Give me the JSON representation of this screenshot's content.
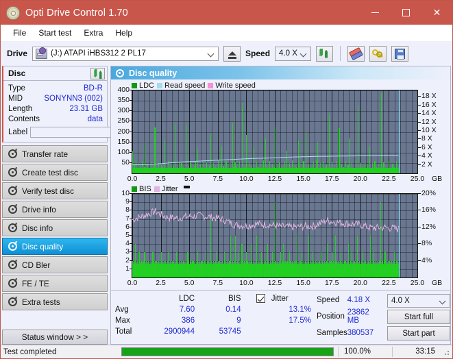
{
  "window": {
    "title": "Opti Drive Control 1.70",
    "icon": "disc-icon",
    "controls": {
      "minimize": "–",
      "maximize": "□",
      "close": "✕"
    }
  },
  "menu": {
    "items": [
      "File",
      "Start test",
      "Extra",
      "Help"
    ]
  },
  "toolbar": {
    "drive_label": "Drive",
    "drive_value": "(J:)   ATAPI iHBS312   2 PL17",
    "eject_icon": "eject-icon",
    "speed_label": "Speed",
    "speed_value": "4.0 X",
    "refresh_icon": "refresh-icon",
    "erase_icon": "eraser-icon",
    "key_icon": "key-icon",
    "save_icon": "save-icon"
  },
  "sidebar": {
    "disc_panel": {
      "title": "Disc",
      "refresh_icon": "refresh-icon",
      "rows": [
        {
          "key": "Type",
          "value": "BD-R"
        },
        {
          "key": "MID",
          "value": "SONYNN3 (002)"
        },
        {
          "key": "Length",
          "value": "23.31 GB"
        },
        {
          "key": "Contents",
          "value": "data"
        }
      ],
      "label_key": "Label",
      "label_value": "",
      "label_placeholder": "",
      "disc_icon": "cd-icon"
    },
    "items": [
      {
        "label": "Transfer rate",
        "active": false
      },
      {
        "label": "Create test disc",
        "active": false
      },
      {
        "label": "Verify test disc",
        "active": false
      },
      {
        "label": "Drive info",
        "active": false
      },
      {
        "label": "Disc info",
        "active": false
      },
      {
        "label": "Disc quality",
        "active": true
      },
      {
        "label": "CD Bler",
        "active": false
      },
      {
        "label": "FE / TE",
        "active": false
      },
      {
        "label": "Extra tests",
        "active": false
      }
    ],
    "status_window_button": "Status window > >"
  },
  "main": {
    "header_title": "Disc quality",
    "header_icon": "disc-quality-icon"
  },
  "chart_data": [
    {
      "type": "bar",
      "id": "ldc-chart",
      "title": "",
      "legend": [
        {
          "label": "LDC",
          "color": "#119911"
        },
        {
          "label": "Read speed",
          "color": "#9fdcf5"
        },
        {
          "label": "Write speed",
          "color": "#f58fd8"
        }
      ],
      "legend_position": "top-left",
      "xlabel": "GB",
      "ylabel": "",
      "xlim": [
        0,
        25
      ],
      "ylim": [
        0,
        400
      ],
      "xticks": [
        "0.0",
        "2.5",
        "5.0",
        "7.5",
        "10.0",
        "12.5",
        "15.0",
        "17.5",
        "20.0",
        "22.5",
        "25.0"
      ],
      "yticks": [
        50,
        100,
        150,
        200,
        250,
        300,
        350,
        400
      ],
      "y2ticks": [
        "2 X",
        "4 X",
        "6 X",
        "8 X",
        "10 X",
        "12 X",
        "14 X",
        "16 X",
        "18 X"
      ],
      "y2lim": [
        0,
        19.5
      ],
      "grid": true,
      "plot_bg": "#697790",
      "series": [
        {
          "name": "LDC",
          "color": "#22d022",
          "note": "dense error-count spikes across 0-23.3 GB, baseline ~20-60, frequent peaks 100-250, max 386",
          "values": [
            105,
            22,
            40,
            18,
            62,
            26,
            14,
            48,
            20,
            34,
            16,
            58,
            12,
            30,
            150,
            24,
            18,
            44,
            12,
            28,
            16,
            60,
            22,
            14,
            36,
            220,
            18,
            26,
            14,
            50,
            20,
            12,
            42,
            16,
            30,
            24,
            160,
            14,
            36,
            18,
            58,
            22,
            12,
            44,
            26,
            16,
            38,
            12,
            240,
            18,
            30,
            14,
            56,
            20,
            12,
            48,
            16,
            34,
            26,
            18,
            238,
            14,
            40,
            22,
            12,
            52,
            18,
            28,
            14,
            36,
            20,
            58,
            16,
            120,
            24,
            14,
            46,
            18,
            30,
            12,
            64,
            22,
            16,
            54,
            26,
            14,
            38,
            18,
            190,
            24,
            12,
            50,
            16,
            32,
            20,
            14,
            62,
            26,
            18,
            44,
            130,
            16,
            36,
            22,
            12,
            58,
            18,
            26,
            14,
            48,
            20,
            16,
            244,
            30,
            12,
            54,
            18,
            34,
            22,
            14,
            60,
            26,
            16,
            340,
            24,
            12,
            46,
            18,
            186,
            28,
            14,
            52,
            20,
            16,
            38,
            24,
            130,
            18,
            12,
            56,
            22,
            30,
            14,
            48,
            18,
            26,
            16,
            62,
            22,
            170,
            14,
            40,
            18,
            12,
            58,
            24,
            16,
            46,
            20,
            30,
            14,
            222,
            18,
            26,
            12,
            54,
            20,
            16,
            38,
            24,
            14,
            58,
            18,
            110,
            26,
            12,
            48,
            20,
            16,
            62,
            24,
            14,
            40,
            18,
            30,
            22,
            160,
            12,
            52,
            18,
            26,
            14,
            58,
            20,
            16,
            200,
            28,
            12,
            44,
            18,
            34,
            22,
            14,
            56,
            20,
            16,
            62,
            24,
            150,
            18,
            12,
            48,
            26,
            14,
            58,
            20,
            30,
            16,
            44,
            18,
            12,
            286,
            24,
            14,
            52,
            18,
            28,
            20,
            16,
            60,
            22,
            14,
            218,
            26,
            12,
            46,
            18,
            30,
            14,
            58,
            22,
            16,
            40,
            170,
            24,
            12,
            54,
            18,
            26,
            20,
            14,
            62,
            16,
            324,
            22,
            12,
            48,
            18,
            32,
            24,
            14,
            56,
            20,
            16,
            42,
            18,
            130,
            26,
            12,
            50,
            22,
            14,
            58,
            18,
            30,
            16,
            44,
            24,
            12,
            388,
            20,
            14,
            52,
            18,
            28,
            22,
            16,
            60,
            14,
            24,
            18,
            12,
            46,
            20,
            30,
            14,
            58,
            22,
            16
          ]
        },
        {
          "name": "Read speed",
          "color": "#a8ddf5",
          "note": "stair-stepping CAV-like read speed from ~2.0X at 0 GB up to ~4.2X at 23.3 GB",
          "points": [
            {
              "x": 0.0,
              "y": 2.0
            },
            {
              "x": 1.5,
              "y": 2.1
            },
            {
              "x": 3.0,
              "y": 2.4
            },
            {
              "x": 4.5,
              "y": 2.7
            },
            {
              "x": 6.0,
              "y": 2.9
            },
            {
              "x": 7.5,
              "y": 3.1
            },
            {
              "x": 9.0,
              "y": 3.3
            },
            {
              "x": 10.5,
              "y": 3.5
            },
            {
              "x": 12.0,
              "y": 3.6
            },
            {
              "x": 13.5,
              "y": 3.8
            },
            {
              "x": 15.0,
              "y": 3.9
            },
            {
              "x": 16.5,
              "y": 4.0
            },
            {
              "x": 18.0,
              "y": 4.05
            },
            {
              "x": 19.5,
              "y": 4.1
            },
            {
              "x": 21.0,
              "y": 4.15
            },
            {
              "x": 22.0,
              "y": 4.2
            },
            {
              "x": 23.3,
              "y": 4.2
            }
          ]
        },
        {
          "name": "Write speed",
          "color": "#f58fd8",
          "values": []
        }
      ],
      "cursor_x": 23.35
    },
    {
      "type": "bar",
      "id": "bis-chart",
      "title": "",
      "legend": [
        {
          "label": "BIS",
          "color": "#119911"
        },
        {
          "label": "Jitter",
          "color": "#e0b4de"
        }
      ],
      "legend_position": "top-left",
      "xlabel": "GB",
      "ylabel": "",
      "xlim": [
        0,
        25
      ],
      "ylim": [
        0,
        10
      ],
      "xticks": [
        "0.0",
        "2.5",
        "5.0",
        "7.5",
        "10.0",
        "12.5",
        "15.0",
        "17.5",
        "20.0",
        "22.5",
        "25.0"
      ],
      "yticks": [
        1,
        2,
        3,
        4,
        5,
        6,
        7,
        8,
        9,
        10
      ],
      "y2ticks": [
        "4%",
        "8%",
        "12%",
        "16%",
        "20%"
      ],
      "y2lim": [
        0,
        20
      ],
      "grid": true,
      "plot_bg": "#697790",
      "series": [
        {
          "name": "BIS",
          "color": "#22d022",
          "note": "dense baseline ~1-2 with frequent spikes to 3-5, occasional to 9",
          "values": [
            2,
            1,
            2,
            4,
            1,
            2,
            1,
            3,
            2,
            1,
            2,
            1,
            2,
            3,
            1,
            2,
            1,
            2,
            2,
            1,
            2,
            1,
            3,
            2,
            1,
            2,
            2,
            1,
            2,
            1,
            2,
            3,
            1,
            2,
            1,
            2,
            2,
            1,
            2,
            3,
            1,
            2,
            1,
            2,
            1,
            2,
            2,
            1,
            3,
            2,
            1,
            2,
            1,
            2,
            1,
            2,
            2,
            1,
            2,
            1,
            3,
            2,
            1,
            2,
            1,
            2,
            2,
            1,
            2,
            1,
            2,
            3,
            1,
            2,
            1,
            2,
            2,
            1,
            2,
            1,
            3,
            2,
            1,
            2,
            1,
            7,
            2,
            1,
            2,
            1,
            2,
            3,
            1,
            2,
            1,
            2,
            2,
            1,
            2,
            1,
            3,
            2,
            1,
            2,
            1,
            2,
            2,
            5,
            1,
            2,
            1,
            2,
            5,
            1,
            2,
            3,
            1,
            2,
            1,
            4,
            2,
            1,
            2,
            1,
            3,
            2,
            1,
            2,
            1,
            2,
            4,
            1,
            2,
            1,
            2,
            5,
            1,
            2,
            1,
            2,
            3,
            1,
            2,
            1,
            2,
            2,
            1,
            4,
            2,
            1,
            2,
            1,
            3,
            2,
            1,
            2,
            9,
            1,
            2,
            1,
            2,
            3,
            1,
            2,
            4,
            1,
            2,
            1,
            2,
            2,
            1,
            3,
            2,
            1,
            2,
            1,
            2,
            1,
            2,
            5,
            1,
            2,
            1,
            2,
            3,
            1,
            2,
            1,
            2,
            2,
            1,
            2,
            5,
            1,
            2,
            1,
            3,
            2,
            1,
            2,
            1,
            2,
            1,
            2,
            2,
            1,
            3,
            2,
            1,
            2,
            1,
            2,
            4,
            1,
            2,
            1,
            2,
            3,
            1,
            2,
            1,
            5,
            2,
            1,
            2,
            1,
            2,
            3,
            1,
            2,
            1,
            2,
            2,
            1,
            2,
            4,
            1,
            2,
            1,
            3,
            2,
            1,
            2,
            1,
            2,
            5,
            1,
            2,
            1,
            2,
            3,
            1,
            2,
            1,
            2,
            2,
            1,
            2,
            1,
            5,
            2,
            1,
            3,
            2,
            1,
            2,
            1,
            2,
            1,
            2,
            9,
            1,
            2,
            1,
            2,
            3,
            1,
            2,
            1,
            2,
            2,
            1,
            2,
            1,
            2,
            3,
            1,
            2,
            1,
            2
          ]
        },
        {
          "name": "Jitter",
          "color": "#e0b4de",
          "note": "noisy band ~7.0-7.5 at start decaying to ~5.8-6.2 at end; percent scale = value*2",
          "points": [
            {
              "x": 0.0,
              "y": 6.9
            },
            {
              "x": 1.0,
              "y": 7.4
            },
            {
              "x": 2.0,
              "y": 7.9
            },
            {
              "x": 3.0,
              "y": 7.2
            },
            {
              "x": 4.0,
              "y": 7.1
            },
            {
              "x": 5.0,
              "y": 7.3
            },
            {
              "x": 6.0,
              "y": 7.4
            },
            {
              "x": 7.0,
              "y": 7.2
            },
            {
              "x": 8.0,
              "y": 6.9
            },
            {
              "x": 9.0,
              "y": 6.3
            },
            {
              "x": 10.0,
              "y": 6.2
            },
            {
              "x": 11.0,
              "y": 6.4
            },
            {
              "x": 12.0,
              "y": 6.3
            },
            {
              "x": 13.0,
              "y": 6.1
            },
            {
              "x": 14.0,
              "y": 6.0
            },
            {
              "x": 15.0,
              "y": 6.1
            },
            {
              "x": 16.0,
              "y": 6.2
            },
            {
              "x": 17.0,
              "y": 6.8
            },
            {
              "x": 18.0,
              "y": 6.6
            },
            {
              "x": 19.0,
              "y": 6.4
            },
            {
              "x": 20.0,
              "y": 6.3
            },
            {
              "x": 21.0,
              "y": 5.9
            },
            {
              "x": 22.0,
              "y": 6.0
            },
            {
              "x": 23.3,
              "y": 5.8
            }
          ]
        }
      ],
      "cursor_x": 23.35
    }
  ],
  "stats": {
    "columns": [
      "LDC",
      "BIS"
    ],
    "rows": [
      {
        "label": "Avg",
        "ldc": "7.60",
        "bis": "0.14",
        "jitter": "13.1%"
      },
      {
        "label": "Max",
        "ldc": "386",
        "bis": "9",
        "jitter": "17.5%"
      },
      {
        "label": "Total",
        "ldc": "2900944",
        "bis": "53745",
        "jitter": ""
      }
    ],
    "jitter_label": "Jitter",
    "jitter_checked": true,
    "right": [
      {
        "key": "Speed",
        "value": "4.18 X"
      },
      {
        "key": "Position",
        "value": "23862 MB"
      },
      {
        "key": "Samples",
        "value": "380537"
      }
    ],
    "speed_select": "4.0 X",
    "start_full_button": "Start full",
    "start_part_button": "Start part"
  },
  "statusbar": {
    "text": "Test completed",
    "progress_percent": "100.0%",
    "progress_value": 100,
    "elapsed": "33:15"
  },
  "colors": {
    "titlebar": "#c9564b",
    "accent_blue": "#1e2ad6",
    "plot_bg": "#697790",
    "bar_green": "#22d022",
    "jitter_pink": "#e0b4de",
    "read_speed": "#a8ddf5",
    "progress_green": "#17a317"
  }
}
